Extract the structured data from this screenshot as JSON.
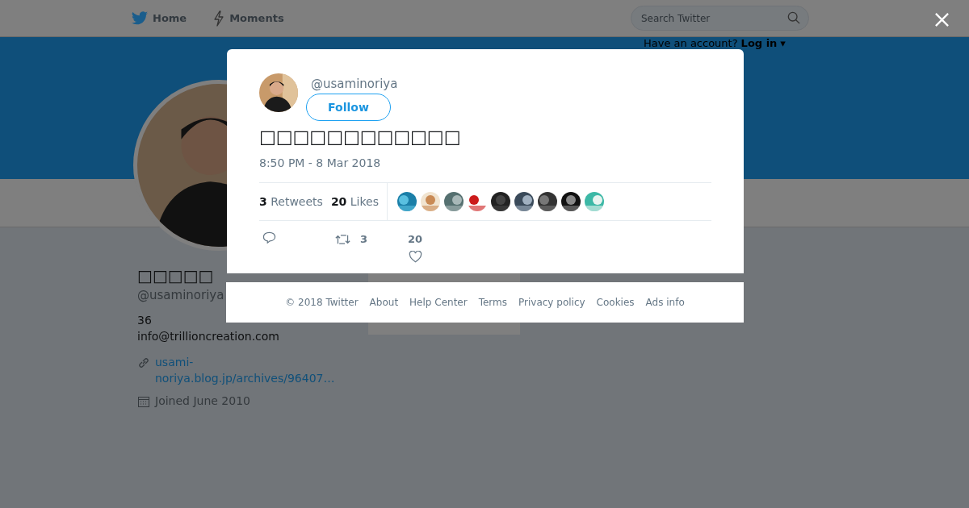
{
  "nav": {
    "items": [
      {
        "kind": "home",
        "label": "Home"
      },
      {
        "kind": "moments",
        "label": "Moments"
      }
    ],
    "search": {
      "placeholder": "Search Twitter"
    },
    "login": {
      "prompt": "Have an account?",
      "link": "Log in",
      "caret": "▾"
    }
  },
  "profile": {
    "name": "□□□□□",
    "handle": "@usaminoriya",
    "bio": [
      "36",
      "info@trillioncreation.com"
    ],
    "url": "usami-noriya.blog.jp/archives/96407…",
    "joined": "Joined June 2010"
  },
  "tweet": {
    "handle": "@usaminoriya",
    "follow": "Follow",
    "text": "□□□□□□□□□□□□",
    "time": "8:50 PM - 8 Mar 2018",
    "retweets": {
      "count": "3",
      "label": "Retweets"
    },
    "likes": {
      "count": "20",
      "label": "Likes"
    },
    "actions": [
      {
        "kind": "reply"
      },
      {
        "kind": "retweet",
        "count": "3"
      },
      {
        "kind": "like",
        "count": "20"
      }
    ]
  },
  "footer": [
    "© 2018 Twitter",
    "About",
    "Help Center",
    "Terms",
    "Privacy policy",
    "Cookies",
    "Ads info"
  ]
}
